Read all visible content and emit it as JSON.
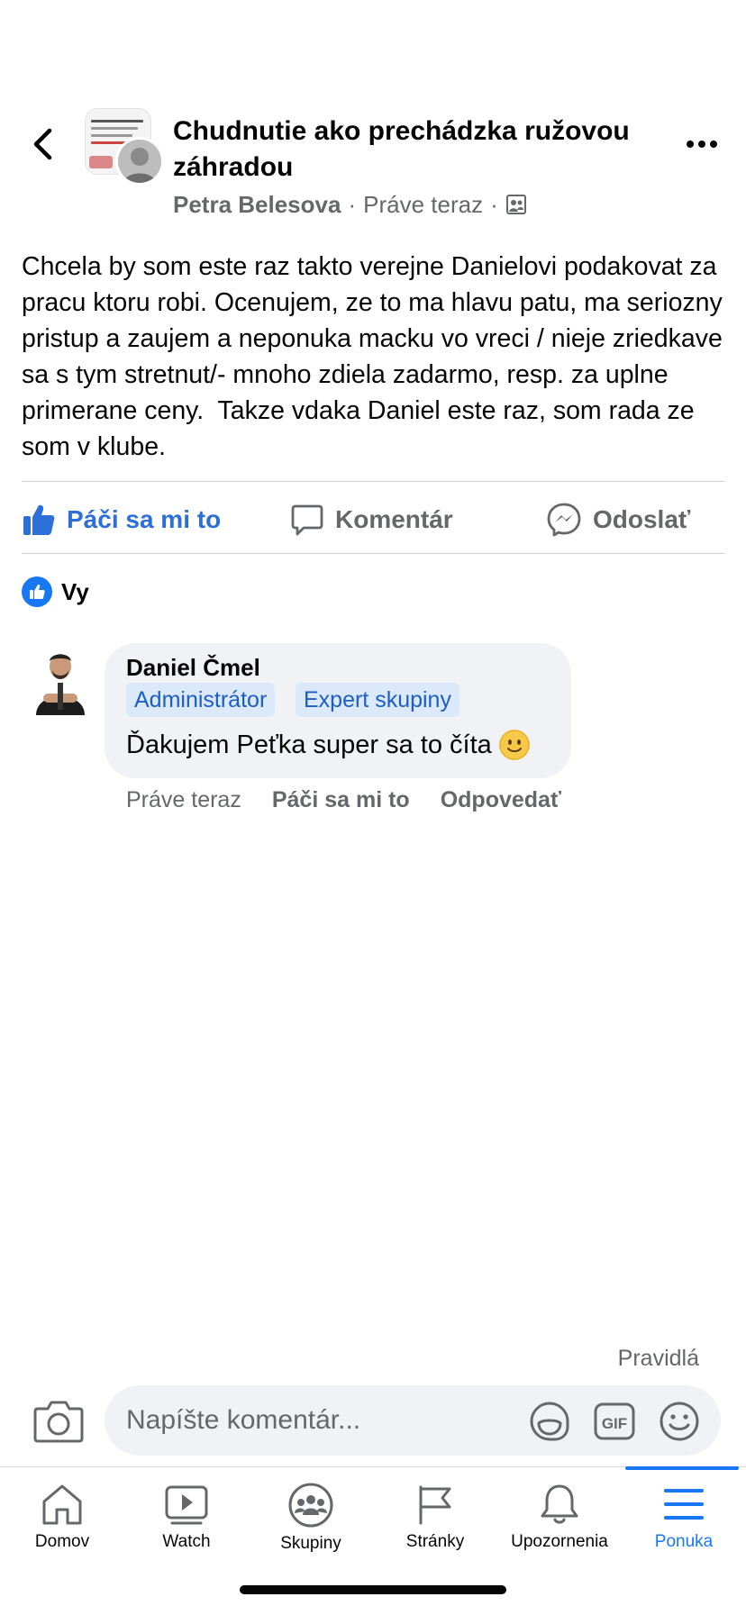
{
  "header": {
    "title": "Chudnutie ako prechádzka ružovou záhradou",
    "author": "Petra Belesova",
    "time": "Práve teraz",
    "separator": "·"
  },
  "post": {
    "body": "Chcela by som este raz takto verejne Danielovi podakovat za pracu ktoru robi. Ocenujem, ze to ma hlavu patu, ma seriozny pristup a zaujem a neponuka macku vo vreci / nieje zriedkave sa s tym stretnut/- mnoho zdiela zadarmo, resp. za uplne primerane ceny.  Takze vdaka Daniel este raz, som rada ze som v klube."
  },
  "actions": {
    "like": "Páči sa mi to",
    "comment": "Komentár",
    "share": "Odoslať"
  },
  "reactions": {
    "label": "Vy"
  },
  "comment": {
    "author": "Daniel Čmel",
    "badges": [
      "Administrátor",
      "Expert skupiny"
    ],
    "text": "Ďakujem Peťka super sa to číta",
    "time": "Práve teraz",
    "like": "Páči sa mi to",
    "reply": "Odpovedať"
  },
  "composer": {
    "rules": "Pravidlá",
    "placeholder": "Napíšte komentár..."
  },
  "tabbar": {
    "tabs": [
      {
        "label": "Domov",
        "icon": "home-icon"
      },
      {
        "label": "Watch",
        "icon": "watch-icon"
      },
      {
        "label": "Skupiny",
        "icon": "groups-icon"
      },
      {
        "label": "Stránky",
        "icon": "flag-icon"
      },
      {
        "label": "Upozornenia",
        "icon": "bell-icon"
      },
      {
        "label": "Ponuka",
        "icon": "menu-icon",
        "active": true
      }
    ]
  },
  "colors": {
    "accent": "#1877f2",
    "secondary_text": "#65676b",
    "bubble": "#f0f2f5"
  }
}
